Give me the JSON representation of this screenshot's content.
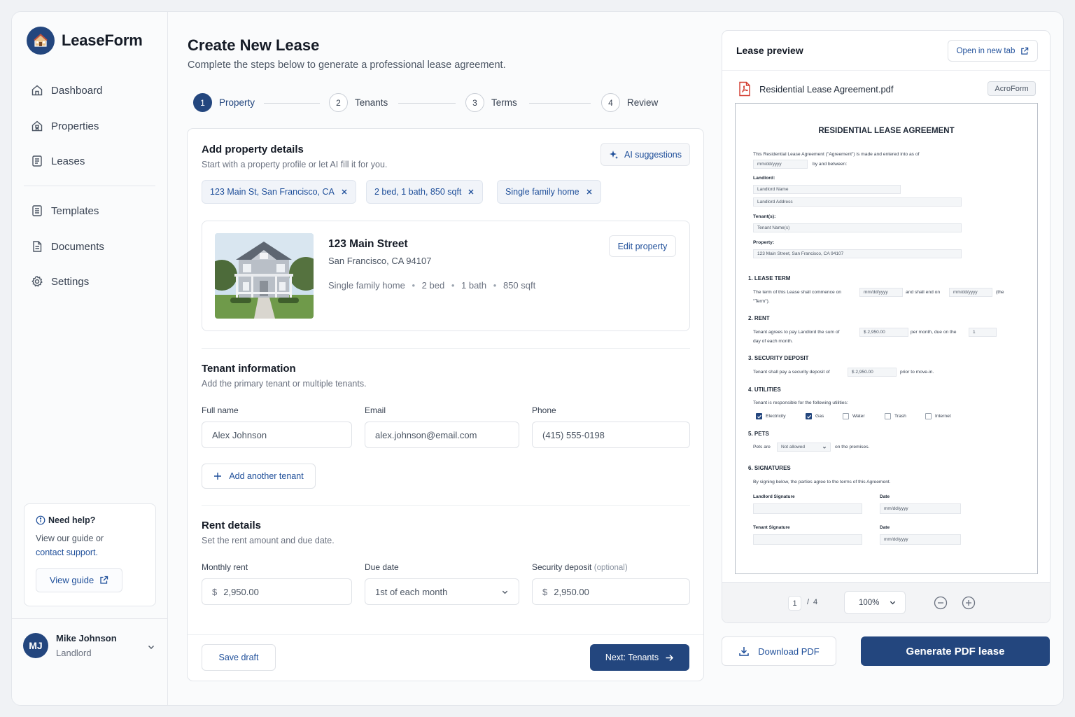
{
  "brand": {
    "name": "LeaseForm",
    "accent": "#23467e"
  },
  "nav": {
    "items": [
      {
        "label": "Dashboard",
        "icon": "home-icon"
      },
      {
        "label": "Properties",
        "icon": "building-icon"
      },
      {
        "label": "Leases",
        "icon": "document-icon"
      },
      {
        "label": "Templates",
        "icon": "template-icon"
      },
      {
        "label": "Documents",
        "icon": "file-icon"
      },
      {
        "label": "Settings",
        "icon": "gear-icon"
      }
    ]
  },
  "help": {
    "title": "Need help?",
    "text": "View our guide or",
    "link": "contact support.",
    "button": "View guide"
  },
  "user": {
    "initials": "MJ",
    "name": "Mike Johnson",
    "role": "Landlord"
  },
  "header": {
    "title": "Create New Lease",
    "subtitle": "Complete the steps below to generate a professional lease agreement."
  },
  "steps": [
    {
      "num": "1",
      "label": "Property",
      "active": true
    },
    {
      "num": "2",
      "label": "Tenants",
      "active": false
    },
    {
      "num": "3",
      "label": "Terms",
      "active": false
    },
    {
      "num": "4",
      "label": "Review",
      "active": false
    }
  ],
  "property_section": {
    "title": "Add property details",
    "subtitle": "Start with a property profile or let AI fill it for you.",
    "ai_button": "AI suggestions",
    "chips": [
      "123 Main St, San Francisco, CA",
      "2 bed, 1 bath, 850 sqft",
      "Single family home"
    ],
    "property": {
      "name": "123 Main Street",
      "city": "San Francisco, CA 94107",
      "meta": [
        "Single family home",
        "2 bed",
        "1 bath",
        "850 sqft"
      ],
      "edit_button": "Edit property"
    }
  },
  "tenant_section": {
    "title": "Tenant information",
    "subtitle": "Add the primary tenant or multiple tenants.",
    "fields": [
      {
        "label": "Full name",
        "value": "Alex Johnson"
      },
      {
        "label": "Email",
        "value": "alex.johnson@email.com"
      },
      {
        "label": "Phone",
        "value": "(415) 555-0198"
      }
    ],
    "add_button": "Add another tenant"
  },
  "rent_section": {
    "title": "Rent details",
    "subtitle": "Set the rent amount and due date.",
    "monthly_rent_label": "Monthly rent",
    "monthly_rent_prefix": "$",
    "monthly_rent_value": "2,950.00",
    "due_date_label": "Due date",
    "due_date_value": "1st of each month",
    "deposit_label": "Security deposit",
    "deposit_optional": "(optional)",
    "deposit_prefix": "$",
    "deposit_value": "2,950.00"
  },
  "footer": {
    "save_draft": "Save draft",
    "next": "Next: Tenants"
  },
  "preview": {
    "title": "Lease preview",
    "open_new_tab": "Open in new tab",
    "file_name": "Residential Lease Agreement.pdf",
    "badge": "AcroForm",
    "page_current": "1",
    "page_sep": "/",
    "page_total": "4",
    "zoom": "100%"
  },
  "document": {
    "title": "RESIDENTIAL LEASE AGREEMENT",
    "intro": "This Residential Lease Agreement (\"Agreement\") is made and entered into as of",
    "date_placeholder": "mm/dd/yyyy",
    "by_and_between": "by and between:",
    "landlord_label": "Landlord:",
    "landlord_name_ph": "Landlord Name",
    "landlord_address_ph": "Landlord Address",
    "tenants_label": "Tenant(s):",
    "tenant_name_ph": "Tenant Name(s)",
    "property_label": "Property:",
    "property_value": "123 Main Street, San Francisco, CA 94107",
    "s1_title": "1. LEASE TERM",
    "s1_text_a": "The term of this Lease shall commence on",
    "s1_text_b": "and shall end on",
    "s1_text_c": "(the",
    "s1_text_d": "\"Term\").",
    "s2_title": "2. RENT",
    "s2_text_a": "Tenant agrees to pay Landlord the sum of",
    "s2_rent": "$ 2,950.00",
    "s2_text_b": "per month, due on the",
    "s2_day": "1",
    "s2_text_c": "day of each month.",
    "s3_title": "3. SECURITY DEPOSIT",
    "s3_text_a": "Tenant shall pay a security deposit of",
    "s3_deposit": "$ 2,950.00",
    "s3_text_b": "prior to move-in.",
    "s4_title": "4. UTILITIES",
    "s4_text": "Tenant is responsible for the following utilities:",
    "utilities": [
      {
        "label": "Electricity",
        "checked": true
      },
      {
        "label": "Gas",
        "checked": true
      },
      {
        "label": "Water",
        "checked": false
      },
      {
        "label": "Trash",
        "checked": false
      },
      {
        "label": "Internet",
        "checked": false
      }
    ],
    "s5_title": "5. PETS",
    "s5_text_a": "Pets are",
    "s5_select": "Not allowed",
    "s5_text_b": "on the premises.",
    "s6_title": "6. SIGNATURES",
    "s6_text": "By signing below, the parties agree to the terms of this Agreement.",
    "landlord_sig": "Landlord Signature",
    "tenant_sig": "Tenant Signature",
    "date_label": "Date"
  },
  "actions": {
    "download": "Download PDF",
    "generate": "Generate PDF lease"
  }
}
